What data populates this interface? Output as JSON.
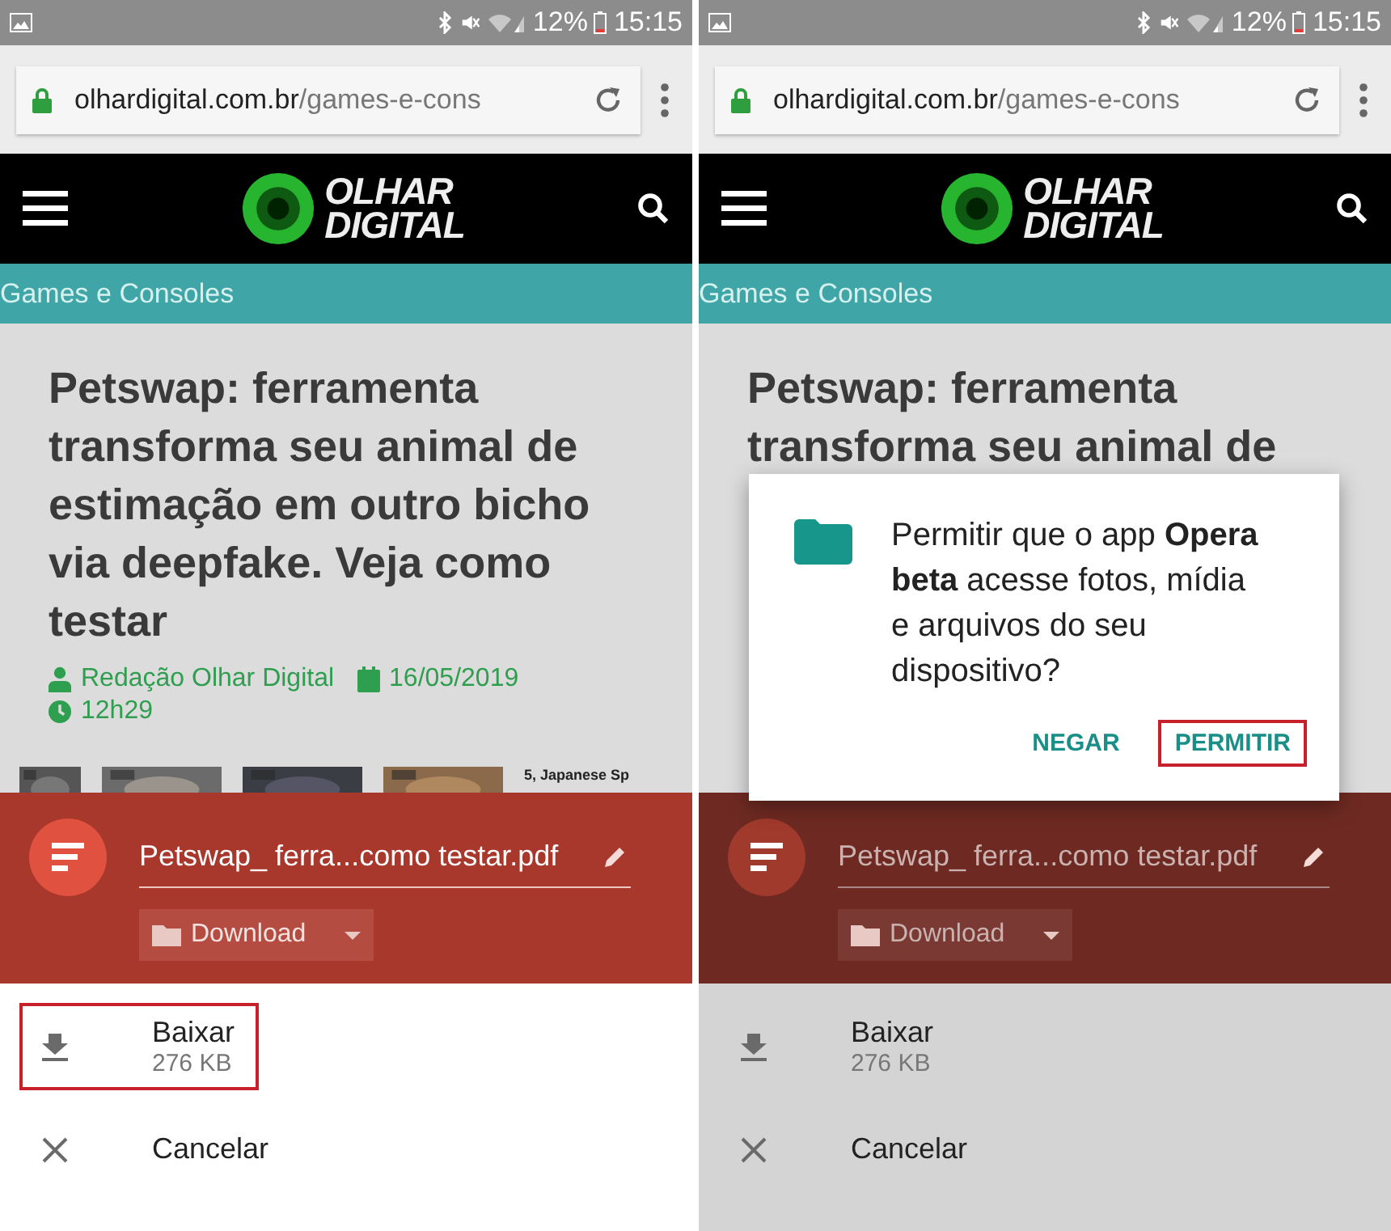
{
  "screens": [
    {
      "status_bar": {
        "battery": "12%",
        "time": "15:15"
      },
      "address_bar": {
        "domain": "olhardigital.com.br",
        "path": "/games-e-cons"
      },
      "site_header": {
        "logo": [
          "OLHAR",
          "DIGITAL"
        ]
      },
      "category": "Games e Consoles",
      "article": {
        "headline": "Petswap: ferramenta transforma seu animal de estimação em outro bicho via deepfake. Veja como testar",
        "author": "Redação Olhar Digital",
        "date": "16/05/2019",
        "time": "12h29",
        "thumbnail_caption": "5, Japanese Sp"
      },
      "download_sheet": {
        "file_name": "Petswap_ ferra...como testar.pdf",
        "folder": "Download",
        "dimmed": false,
        "actions": [
          {
            "kind": "download",
            "label": "Baixar",
            "detail": "276 KB",
            "highlighted": true
          },
          {
            "kind": "cancel",
            "label": "Cancelar",
            "highlighted": false
          }
        ]
      }
    },
    {
      "status_bar": {
        "battery": "12%",
        "time": "15:15"
      },
      "address_bar": {
        "domain": "olhardigital.com.br",
        "path": "/games-e-cons"
      },
      "site_header": {
        "logo": [
          "OLHAR",
          "DIGITAL"
        ]
      },
      "category": "Games e Consoles",
      "article": {
        "headline": "Petswap: ferramenta transforma seu animal de"
      },
      "download_sheet": {
        "file_name": "Petswap_ ferra...como testar.pdf",
        "folder": "Download",
        "dimmed": true,
        "actions": [
          {
            "kind": "download",
            "label": "Baixar",
            "detail": "276 KB",
            "highlighted": false
          },
          {
            "kind": "cancel",
            "label": "Cancelar",
            "highlighted": false
          }
        ]
      },
      "permission_dialog": {
        "message": "Permitir que o app **Opera beta** acesse fotos, mídia e arquivos do seu dispositivo?",
        "buttons": [
          {
            "label": "NEGAR",
            "highlighted": false
          },
          {
            "label": "PERMITIR",
            "highlighted": true
          }
        ]
      }
    }
  ]
}
